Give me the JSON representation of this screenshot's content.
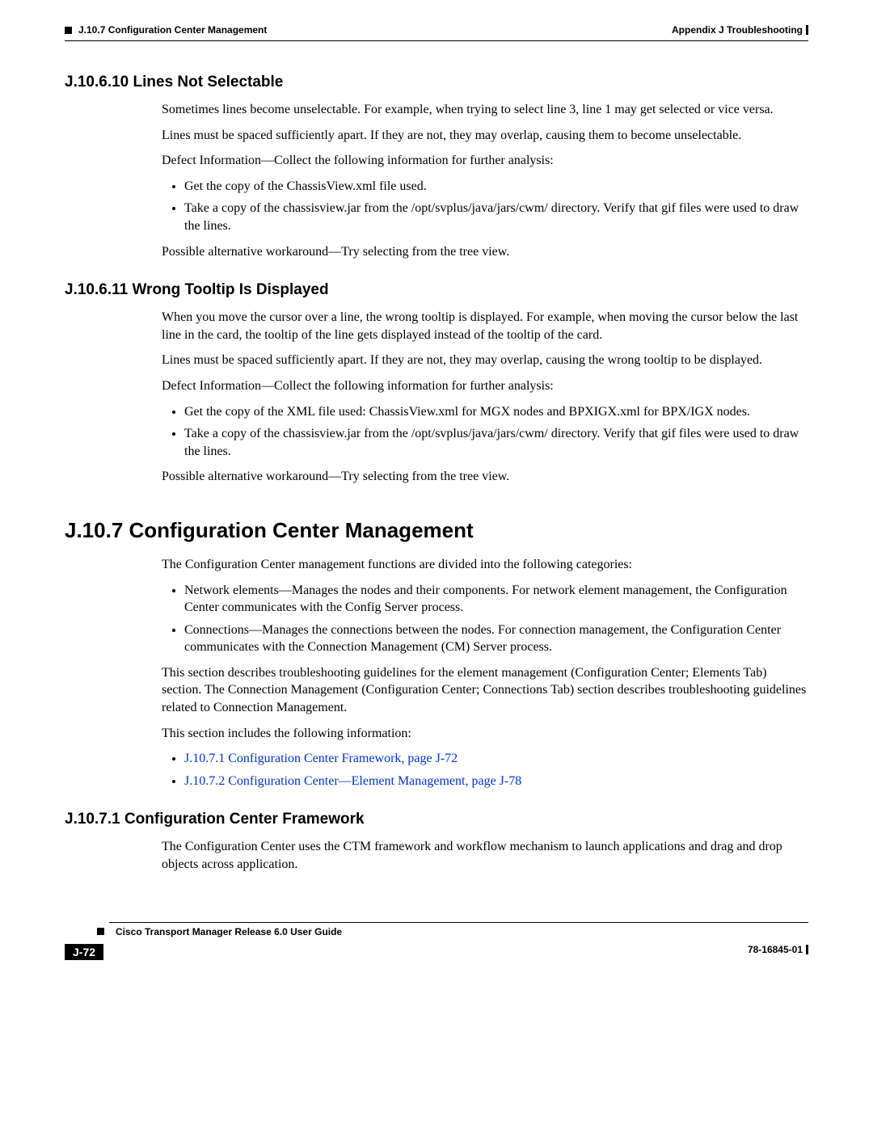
{
  "header": {
    "left": "J.10.7    Configuration Center Management",
    "right": "Appendix J      Troubleshooting"
  },
  "sections": {
    "s1": {
      "heading": "J.10.6.10  Lines Not Selectable",
      "p1": "Sometimes lines become unselectable. For example, when trying to select line 3, line 1 may get selected or vice versa.",
      "p2": "Lines must be spaced sufficiently apart. If they are not, they may overlap, causing them to become unselectable.",
      "p3": "Defect Information—Collect the following information for further analysis:",
      "b1": "Get the copy of the ChassisView.xml file used.",
      "b2": "Take a copy of the chassisview.jar from the /opt/svplus/java/jars/cwm/ directory. Verify that gif files were used to draw the lines.",
      "p4": "Possible alternative workaround—Try selecting from the tree view."
    },
    "s2": {
      "heading": "J.10.6.11  Wrong Tooltip Is Displayed",
      "p1": "When you move the cursor over a line, the wrong tooltip is displayed. For example, when moving the cursor below the last line in the card, the tooltip of the line gets displayed instead of the tooltip of the card.",
      "p2": "Lines must be spaced sufficiently apart. If they are not, they may overlap, causing the wrong tooltip to be displayed.",
      "p3": "Defect Information—Collect the following information for further analysis:",
      "b1": "Get the copy of the XML file used: ChassisView.xml for MGX nodes and BPXIGX.xml for BPX/IGX nodes.",
      "b2": "Take a copy of the chassisview.jar from the /opt/svplus/java/jars/cwm/ directory. Verify that gif files were used to draw the lines.",
      "p4": "Possible alternative workaround—Try selecting from the tree view."
    },
    "s3": {
      "heading": "J.10.7  Configuration Center Management",
      "p1": "The Configuration Center management functions are divided into the following categories:",
      "b1": "Network elements—Manages the nodes and their components. For network element management, the Configuration Center communicates with the Config Server process.",
      "b2": "Connections—Manages the connections between the nodes. For connection management, the Configuration Center communicates with the Connection Management (CM) Server process.",
      "p2": "This section describes troubleshooting guidelines for the element management (Configuration Center; Elements Tab) section. The Connection Management (Configuration Center; Connections Tab) section describes troubleshooting guidelines related to Connection Management.",
      "p3": "This section includes the following information:",
      "l1": "J.10.7.1  Configuration Center Framework, page J-72",
      "l2": "J.10.7.2  Configuration Center—Element Management, page J-78"
    },
    "s4": {
      "heading": "J.10.7.1  Configuration Center Framework",
      "p1": "The Configuration Center uses the CTM framework and workflow mechanism to launch applications and drag and drop objects across application."
    }
  },
  "footer": {
    "title": "Cisco Transport Manager Release 6.0 User Guide",
    "page": "J-72",
    "docnum": "78-16845-01"
  }
}
